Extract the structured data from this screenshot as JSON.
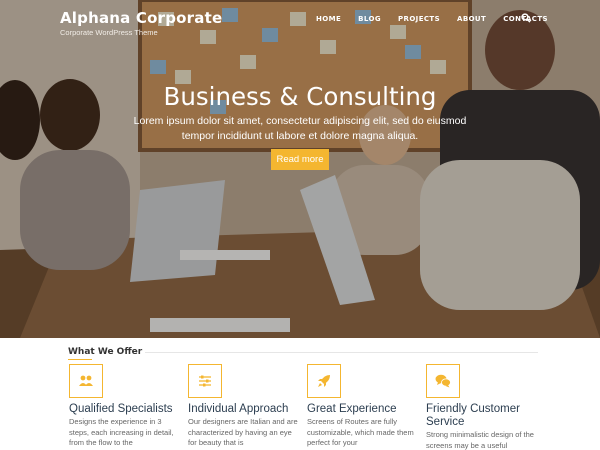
{
  "header": {
    "brand_title": "Alphana Corporate",
    "brand_tagline": "Corporate WordPress Theme",
    "nav": [
      "HOME",
      "BLOG",
      "PROJECTS",
      "ABOUT",
      "CONTACTS"
    ],
    "search_icon": "search-icon"
  },
  "hero": {
    "heading": "Business & Consulting",
    "subtext": "Lorem ipsum dolor sit amet, consectetur adipiscing elit, sed do eiusmod tempor incididunt ut labore et dolore magna aliqua.",
    "button_label": "Read more",
    "button_color": "#f4b630"
  },
  "offer": {
    "heading": "What We Offer",
    "accent_color": "#f4b630",
    "features": [
      {
        "icon": "users-icon",
        "title": "Qualified Specialists",
        "desc": "Designs the experience in 3 steps, each increasing in detail, from the flow to the"
      },
      {
        "icon": "sliders-icon",
        "title": "Individual Approach",
        "desc": "Our designers are Italian and are characterized by having an eye for beauty that is"
      },
      {
        "icon": "rocket-icon",
        "title": "Great Experience",
        "desc": "Screens of Routes are fully customizable, which made them perfect for your"
      },
      {
        "icon": "chat-bubbles-icon",
        "title": "Friendly Customer Service",
        "desc": "Strong minimalistic design of the screens may be a useful"
      }
    ]
  }
}
